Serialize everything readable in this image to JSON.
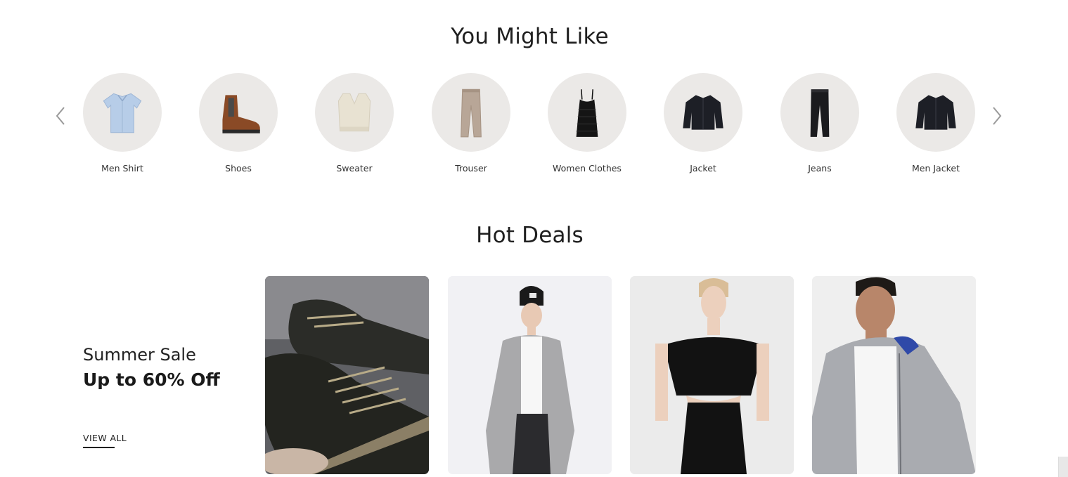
{
  "you_might_like": {
    "title": "You Might Like",
    "prev_icon": "chevron-left-icon",
    "next_icon": "chevron-right-icon",
    "categories": [
      {
        "label": "Men Shirt",
        "icon": "shirt-icon"
      },
      {
        "label": "Shoes",
        "icon": "boot-icon"
      },
      {
        "label": "Sweater",
        "icon": "sweater-vest-icon"
      },
      {
        "label": "Trouser",
        "icon": "trouser-icon"
      },
      {
        "label": "Women Clothes",
        "icon": "dress-icon"
      },
      {
        "label": "Jacket",
        "icon": "jacket-icon"
      },
      {
        "label": "Jeans",
        "icon": "jeans-icon"
      },
      {
        "label": "Men Jacket",
        "icon": "jacket-icon"
      }
    ]
  },
  "hot_deals": {
    "title": "Hot Deals",
    "promo": {
      "subtitle": "Summer Sale",
      "headline": "Up to 60% Off",
      "cta": "VIEW ALL"
    },
    "products": [
      {
        "image": "sneaker-photo"
      },
      {
        "image": "beanie-cardigan-model-photo"
      },
      {
        "image": "black-dress-model-photo"
      },
      {
        "image": "grey-hoodie-model-photo"
      }
    ]
  },
  "colors": {
    "text": "#222222",
    "circle_bg": "#ebe9e7",
    "arrow": "#9a9a9a"
  }
}
